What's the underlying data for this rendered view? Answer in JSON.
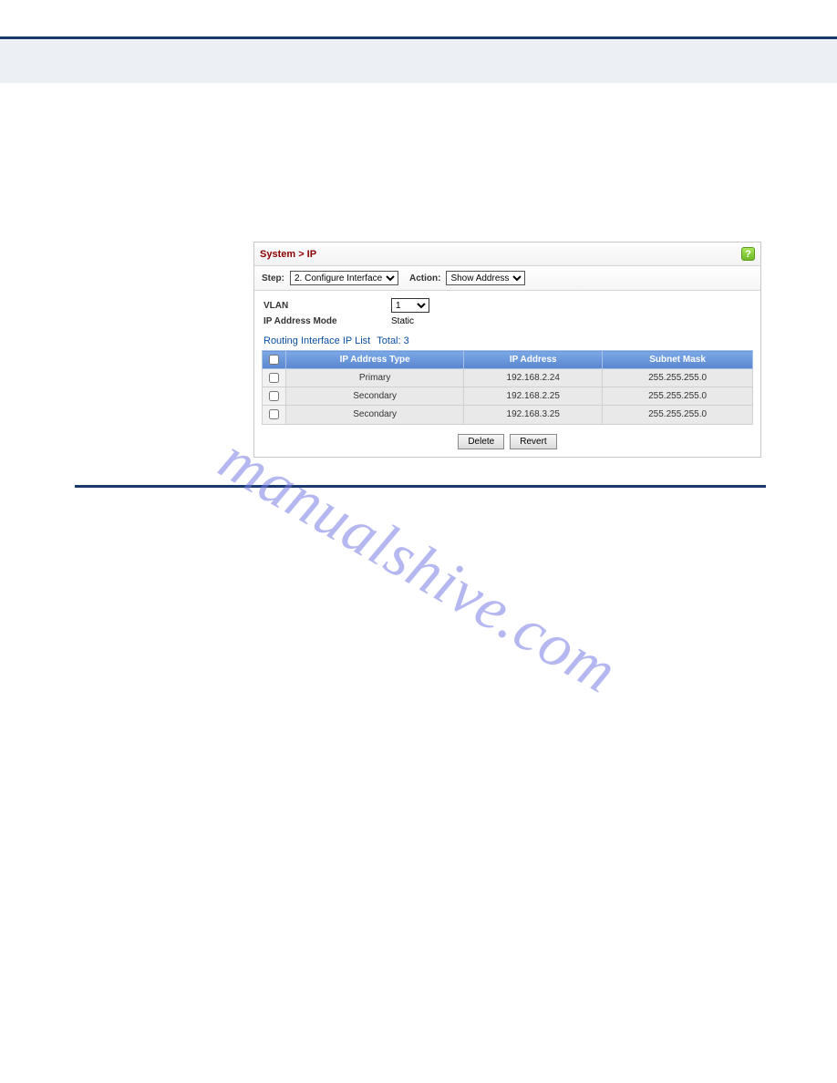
{
  "breadcrumb": "System > IP",
  "help_glyph": "?",
  "step_label": "Step:",
  "step_value": "2. Configure Interface",
  "action_label": "Action:",
  "action_value": "Show Address",
  "fields": {
    "vlan_label": "VLAN",
    "vlan_value": "1",
    "mode_label": "IP Address Mode",
    "mode_value": "Static"
  },
  "list": {
    "title": "Routing Interface IP List",
    "total_text": "Total: 3",
    "cols": {
      "type": "IP Address Type",
      "ip": "IP Address",
      "mask": "Subnet Mask"
    },
    "rows": [
      {
        "type": "Primary",
        "ip": "192.168.2.24",
        "mask": "255.255.255.0"
      },
      {
        "type": "Secondary",
        "ip": "192.168.2.25",
        "mask": "255.255.255.0"
      },
      {
        "type": "Secondary",
        "ip": "192.168.3.25",
        "mask": "255.255.255.0"
      }
    ]
  },
  "buttons": {
    "delete": "Delete",
    "revert": "Revert"
  },
  "watermark": "manualshive.com"
}
